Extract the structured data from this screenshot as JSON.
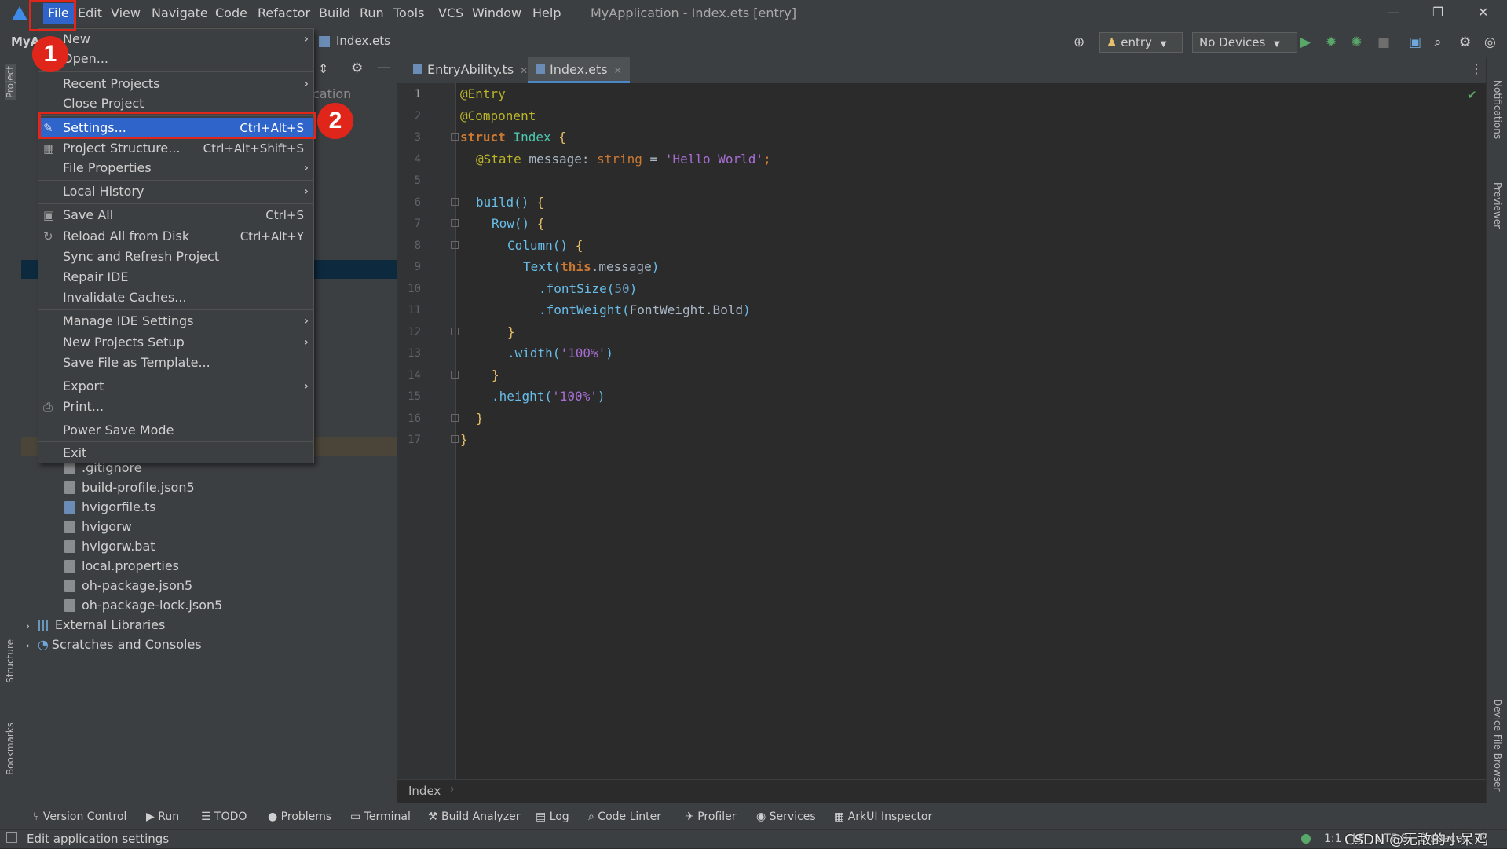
{
  "menubar": {
    "items": [
      "File",
      "Edit",
      "View",
      "Navigate",
      "Code",
      "Refactor",
      "Build",
      "Run",
      "Tools",
      "VCS",
      "Window",
      "Help"
    ],
    "window_title": "MyApplication - Index.ets [entry]"
  },
  "navbar": {
    "file_crumb": "Index.ets",
    "project_crumb": "MyA",
    "module_selector": "entry",
    "device_selector": "No Devices"
  },
  "project_panel": {
    "partial_text": "cation",
    "tree": [
      {
        "label": ".gitignore"
      },
      {
        "label": "build-profile.json5"
      },
      {
        "label": "hvigorfile.ts"
      },
      {
        "label": "hvigorw"
      },
      {
        "label": "hvigorw.bat"
      },
      {
        "label": "local.properties"
      },
      {
        "label": "oh-package.json5"
      },
      {
        "label": "oh-package-lock.json5"
      }
    ],
    "external_libraries": "External Libraries",
    "scratches": "Scratches and Consoles"
  },
  "editor": {
    "tabs": [
      {
        "label": "EntryAbility.ts",
        "active": false
      },
      {
        "label": "Index.ets",
        "active": true
      }
    ],
    "line_numbers": [
      "1",
      "2",
      "3",
      "4",
      "5",
      "6",
      "7",
      "8",
      "9",
      "10",
      "11",
      "12",
      "13",
      "14",
      "15",
      "16",
      "17"
    ],
    "code": {
      "l1": "@Entry",
      "l2": "@Component",
      "l3_kw": "struct",
      "l3_name": "Index",
      "l4_ann": "@State",
      "l4_var": " message: ",
      "l4_type": "string",
      "l4_eq": " = ",
      "l4_str": "'Hello World'",
      "l4_end": ";",
      "l6": "build()",
      "l7": "Row()",
      "l8": "Column()",
      "l9_fn": "Text(",
      "l9_this": "this",
      "l9_rest": ".message",
      "l9_close": ")",
      "l10_fn": ".fontSize(",
      "l10_num": "50",
      "l10_close": ")",
      "l11_fn": ".fontWeight(",
      "l11_arg": "FontWeight.Bold",
      "l11_close": ")",
      "l13_fn": ".width(",
      "l13_str": "'100%'",
      "l13_close": ")",
      "l15_fn": ".height(",
      "l15_str": "'100%'",
      "l15_close": ")",
      "open_brace": "{",
      "close_brace": "}"
    },
    "breadcrumb": "Index"
  },
  "file_menu": {
    "items": [
      {
        "label": "New",
        "shortcut": "",
        "submenu": true
      },
      {
        "label": "Open...",
        "shortcut": "",
        "submenu": false
      },
      {
        "label": "Recent Projects",
        "shortcut": "",
        "submenu": true
      },
      {
        "label": "Close Project",
        "shortcut": "",
        "submenu": false
      },
      {
        "label": "Settings...",
        "shortcut": "Ctrl+Alt+S",
        "submenu": false
      },
      {
        "label": "Project Structure...",
        "shortcut": "Ctrl+Alt+Shift+S",
        "submenu": false
      },
      {
        "label": "File Properties",
        "shortcut": "",
        "submenu": true
      },
      {
        "label": "Local History",
        "shortcut": "",
        "submenu": true
      },
      {
        "label": "Save All",
        "shortcut": "Ctrl+S",
        "submenu": false
      },
      {
        "label": "Reload All from Disk",
        "shortcut": "Ctrl+Alt+Y",
        "submenu": false
      },
      {
        "label": "Sync and Refresh Project",
        "shortcut": "",
        "submenu": false
      },
      {
        "label": "Repair IDE",
        "shortcut": "",
        "submenu": false
      },
      {
        "label": "Invalidate Caches...",
        "shortcut": "",
        "submenu": false
      },
      {
        "label": "Manage IDE Settings",
        "shortcut": "",
        "submenu": true
      },
      {
        "label": "New Projects Setup",
        "shortcut": "",
        "submenu": true
      },
      {
        "label": "Save File as Template...",
        "shortcut": "",
        "submenu": false
      },
      {
        "label": "Export",
        "shortcut": "",
        "submenu": true
      },
      {
        "label": "Print...",
        "shortcut": "",
        "submenu": false
      },
      {
        "label": "Power Save Mode",
        "shortcut": "",
        "submenu": false
      },
      {
        "label": "Exit",
        "shortcut": "",
        "submenu": false
      }
    ]
  },
  "annotations": {
    "step1": "1",
    "step2": "2"
  },
  "left_stripe": {
    "project": "Project",
    "structure": "Structure",
    "bookmarks": "Bookmarks"
  },
  "right_stripe": {
    "notifications": "Notifications",
    "previewer": "Previewer",
    "device_file_browser": "Device File Browser"
  },
  "tool_windows": [
    "Version Control",
    "Run",
    "TODO",
    "Problems",
    "Terminal",
    "Build Analyzer",
    "Log",
    "Code Linter",
    "Profiler",
    "Services",
    "ArkUI Inspector"
  ],
  "statusbar": {
    "message": "Edit application settings",
    "position": "1:1",
    "line_sep": "LF",
    "encoding": "UTF-8",
    "indent": "2 spaces",
    "watermark": "CSDN @无敌的小呆鸡"
  },
  "colors": {
    "accent": "#2f65ca",
    "annotation_red": "#e0261b",
    "run_green": "#59a869"
  }
}
